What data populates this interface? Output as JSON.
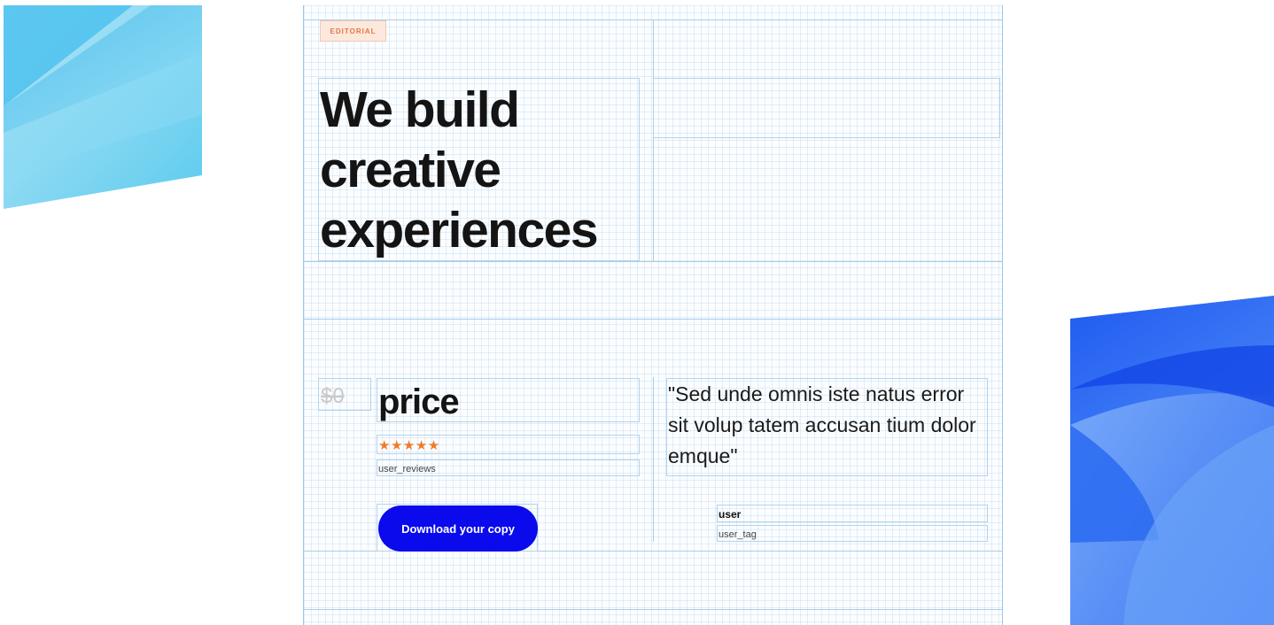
{
  "badge": {
    "label": "EDITORIAL"
  },
  "hero": {
    "headline": "We build creative experiences"
  },
  "pricing": {
    "old_price": "$0",
    "price_label": "price",
    "rating_stars": "★★★★★",
    "rating_value": 5,
    "reviews_label": "user_reviews",
    "cta_label": "Download your copy"
  },
  "testimonial": {
    "quote": "\"Sed unde omnis iste natus error sit volup tatem accusan tium dolor emque\"",
    "user": "user",
    "user_tag": "user_tag"
  },
  "colors": {
    "accent_button": "#0a0aed",
    "badge_text": "#e2783f",
    "badge_bg": "#fde8de",
    "stars": "#f07a2a",
    "grid_lines": "#a9cde8"
  }
}
